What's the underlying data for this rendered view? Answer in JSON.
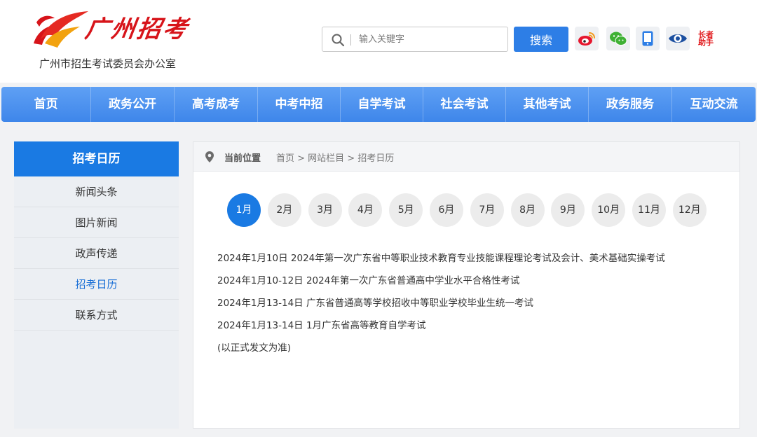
{
  "header": {
    "logo_text": "广州招考",
    "org_name": "广州市招生考试委员会办公室",
    "search_placeholder": "输入关键字",
    "search_button": "搜索",
    "social_icons": [
      "weibo-icon",
      "wechat-icon",
      "mobile-icon",
      "eye-icon",
      "elder-assist-icon"
    ],
    "elder_label_line1": "长者",
    "elder_label_line2": "助手"
  },
  "nav": {
    "items": [
      "首页",
      "政务公开",
      "高考成考",
      "中考中招",
      "自学考试",
      "社会考试",
      "其他考试",
      "政务服务",
      "互动交流"
    ]
  },
  "sidebar": {
    "title": "招考日历",
    "items": [
      "新闻头条",
      "图片新闻",
      "政声传递",
      "招考日历",
      "联系方式"
    ],
    "active_item": "招考日历"
  },
  "breadcrumb": {
    "label": "当前位置",
    "path": "首页 > 网站栏目 > 招考日历"
  },
  "months": {
    "items": [
      "1月",
      "2月",
      "3月",
      "4月",
      "5月",
      "6月",
      "7月",
      "8月",
      "9月",
      "10月",
      "11月",
      "12月"
    ],
    "active": "1月"
  },
  "events": [
    "2024年1月10日 2024年第一次广东省中等职业技术教育专业技能课程理论考试及会计、美术基础实操考试",
    "2024年1月10-12日 2024年第一次广东省普通高中学业水平合格性考试",
    "2024年1月13-14日 广东省普通高等学校招收中等职业学校毕业生统一考试",
    "2024年1月13-14日 1月广东省高等教育自学考试",
    "(以正式发文为准)"
  ],
  "colors": {
    "accent": "#1a7ae3",
    "brand_red": "#d7141a",
    "nav_top": "#5fa0f4",
    "nav_bottom": "#3e86ea"
  }
}
